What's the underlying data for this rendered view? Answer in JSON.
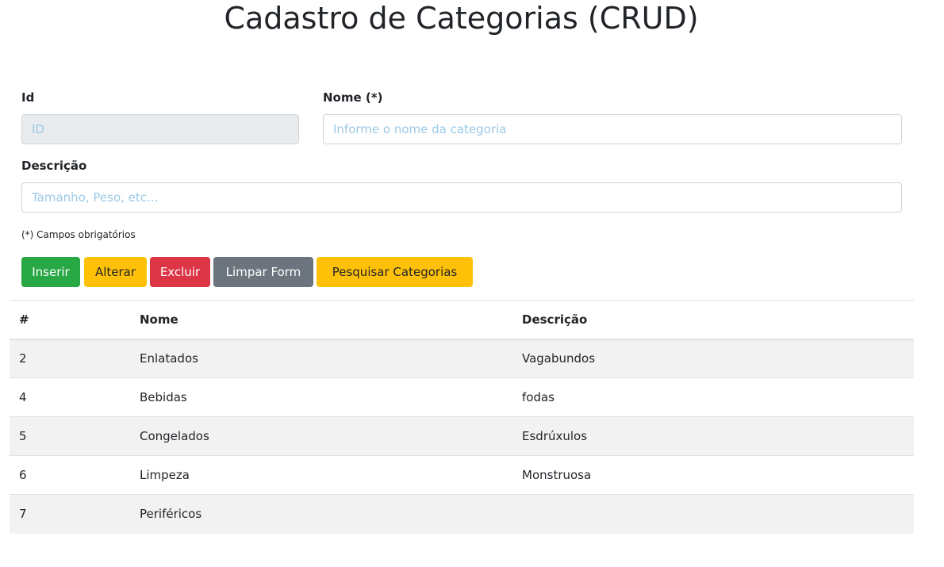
{
  "page": {
    "title": "Cadastro de Categorias (CRUD)"
  },
  "form": {
    "id_label": "Id",
    "id_placeholder": "ID",
    "nome_label": "Nome (*)",
    "nome_placeholder": "Informe o nome da categoria",
    "descricao_label": "Descrição",
    "descricao_placeholder": "Tamanho, Peso, etc...",
    "required_note": "(*) Campos obrigatórios"
  },
  "buttons": {
    "inserir": "Inserir",
    "alterar": "Alterar",
    "excluir": "Excluir",
    "limpar": "Limpar Form",
    "pesquisar": "Pesquisar Categorias"
  },
  "table": {
    "headers": [
      "#",
      "Nome",
      "Descrição"
    ],
    "rows": [
      {
        "id": "2",
        "nome": "Enlatados",
        "descricao": "Vagabundos"
      },
      {
        "id": "4",
        "nome": "Bebidas",
        "descricao": "fodas"
      },
      {
        "id": "5",
        "nome": "Congelados",
        "descricao": "Esdrúxulos"
      },
      {
        "id": "6",
        "nome": "Limpeza",
        "descricao": "Monstruosa"
      },
      {
        "id": "7",
        "nome": "Periféricos",
        "descricao": ""
      }
    ]
  },
  "colors": {
    "success": "#28a745",
    "warning": "#ffc107",
    "danger": "#dc3545",
    "secondary": "#6c757d",
    "stripe": "#f2f2f2"
  }
}
